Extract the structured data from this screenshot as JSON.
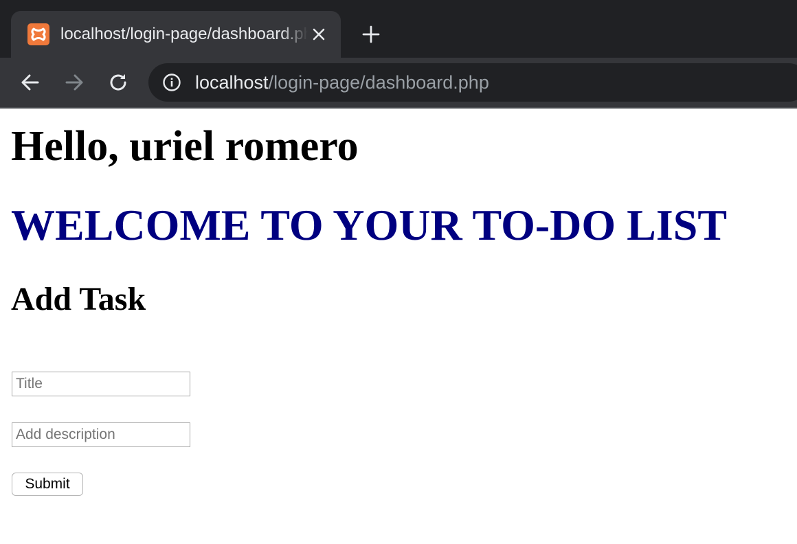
{
  "browser": {
    "tab": {
      "title": "localhost/login-page/dashboard.php",
      "favicon_icon": "xampp-logo-icon",
      "favicon_color": "#f0793b",
      "close_icon": "close-icon"
    },
    "new_tab_icon": "plus-icon",
    "nav": {
      "back_icon": "arrow-left-icon",
      "forward_icon": "arrow-right-icon",
      "reload_icon": "reload-icon"
    },
    "address_bar": {
      "info_icon": "info-icon",
      "host": "localhost",
      "path": "/login-page/dashboard.php"
    },
    "colors": {
      "tabstrip_bg": "#202124",
      "toolbar_bg": "#35363a",
      "text_primary": "#e8eaed",
      "text_secondary": "#9aa0a6"
    }
  },
  "page": {
    "greeting": "Hello, uriel romero",
    "welcome_heading": "WELCOME TO YOUR TO-DO LIST",
    "welcome_color": "#000080",
    "add_task_heading": "Add Task",
    "form": {
      "title_placeholder": "Title",
      "title_value": "",
      "description_placeholder": "Add description",
      "description_value": "",
      "submit_label": "Submit"
    }
  }
}
